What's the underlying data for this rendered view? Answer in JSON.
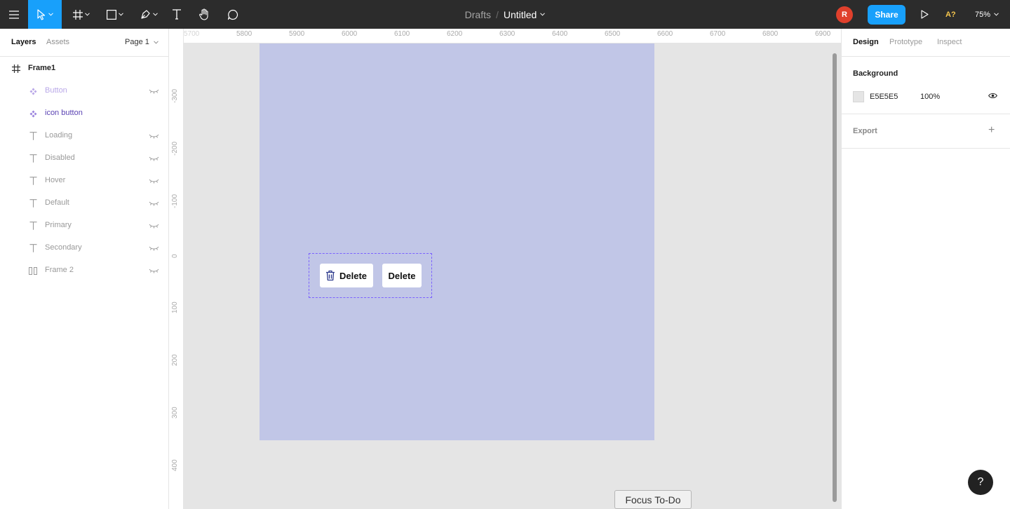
{
  "toolbar": {
    "breadcrumb": "Drafts",
    "title": "Untitled",
    "avatar_initial": "R",
    "share_label": "Share",
    "help_label": "A?",
    "zoom_label": "75%"
  },
  "left_panel": {
    "tabs": [
      {
        "label": "Layers"
      },
      {
        "label": "Assets"
      }
    ],
    "page_selector": "Page 1",
    "layers": [
      {
        "label": "Frame1",
        "icon": "frame-icon",
        "kind": "frame"
      },
      {
        "label": "Button",
        "icon": "component-icon",
        "kind": "component",
        "hidden": true
      },
      {
        "label": "icon button",
        "icon": "component-icon",
        "kind": "component",
        "hidden": false
      },
      {
        "label": "Loading",
        "icon": "text-icon",
        "kind": "text",
        "hidden": true
      },
      {
        "label": "Disabled",
        "icon": "text-icon",
        "kind": "text",
        "hidden": true
      },
      {
        "label": "Hover",
        "icon": "text-icon",
        "kind": "text",
        "hidden": true
      },
      {
        "label": "Default",
        "icon": "text-icon",
        "kind": "text",
        "hidden": true
      },
      {
        "label": "Primary",
        "icon": "text-icon",
        "kind": "text",
        "hidden": true
      },
      {
        "label": "Secondary",
        "icon": "text-icon",
        "kind": "text",
        "hidden": true
      },
      {
        "label": "Frame 2",
        "icon": "columns-icon",
        "kind": "frame-child",
        "hidden": true
      }
    ]
  },
  "rulers": {
    "top": [
      "5700",
      "5800",
      "5900",
      "6000",
      "6100",
      "6200",
      "6300",
      "6400",
      "6500",
      "6600",
      "6700",
      "6800",
      "6900"
    ],
    "left": [
      "-300",
      "-200",
      "-100",
      "0",
      "100",
      "200",
      "300",
      "400"
    ]
  },
  "canvas": {
    "button_icon_label": "Delete",
    "button_plain_label": "Delete",
    "footer_tag": "Focus To-Do"
  },
  "right_panel": {
    "tabs": [
      {
        "label": "Design"
      },
      {
        "label": "Prototype"
      },
      {
        "label": "Inspect"
      }
    ],
    "background_title": "Background",
    "background_hex": "E5E5E5",
    "background_opacity": "100%",
    "export_label": "Export",
    "export_plus": "+"
  },
  "help_fab": "?",
  "colors": {
    "toolbar": "#2c2c2c",
    "accent": "#18a0fb",
    "frame_fill": "#c1c6e7",
    "canvas_bg": "#e5e5e5",
    "selection": "#7b61ff"
  }
}
